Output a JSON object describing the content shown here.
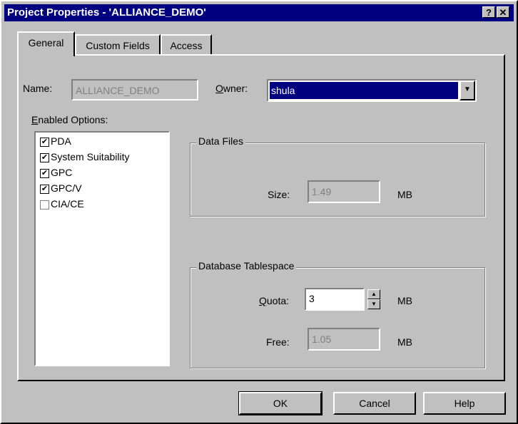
{
  "window": {
    "title": "Project Properties - 'ALLIANCE_DEMO'",
    "help_glyph": "?",
    "close_glyph": "✕"
  },
  "tabs": [
    {
      "label": "General",
      "active": true
    },
    {
      "label": "Custom Fields",
      "active": false
    },
    {
      "label": "Access",
      "active": false
    }
  ],
  "general": {
    "name_label": "Name:",
    "name_value": "ALLIANCE_DEMO",
    "owner_label_u": "O",
    "owner_label_rest": "wner:",
    "owner_value": "shula",
    "enabled_label_u": "E",
    "enabled_label_rest": "nabled Options:",
    "options": [
      {
        "label": "PDA",
        "checked": true,
        "mark": "✔"
      },
      {
        "label": "System Suitability",
        "checked": true,
        "mark": "✔"
      },
      {
        "label": "GPC",
        "checked": true,
        "mark": "✔"
      },
      {
        "label": "GPC/V",
        "checked": true,
        "mark": "✔"
      },
      {
        "label": "CIA/CE",
        "checked": false,
        "mark": ""
      }
    ],
    "data_files": {
      "title": "Data Files",
      "size_label": "Size:",
      "size_value": "1.49",
      "unit": "MB"
    },
    "tablespace": {
      "title": "Database Tablespace",
      "quota_label_u": "Q",
      "quota_label_rest": "uota:",
      "quota_value": "3",
      "quota_unit": "MB",
      "free_label": "Free:",
      "free_value": "1.05",
      "free_unit": "MB"
    }
  },
  "buttons": {
    "ok": "OK",
    "cancel": "Cancel",
    "help": "Help"
  },
  "icons": {
    "dropdown": "▼",
    "spin_up": "▲",
    "spin_down": "▼"
  },
  "colors": {
    "titlebar": "#000080",
    "face": "#c0c0c0",
    "selection": "#000080"
  }
}
